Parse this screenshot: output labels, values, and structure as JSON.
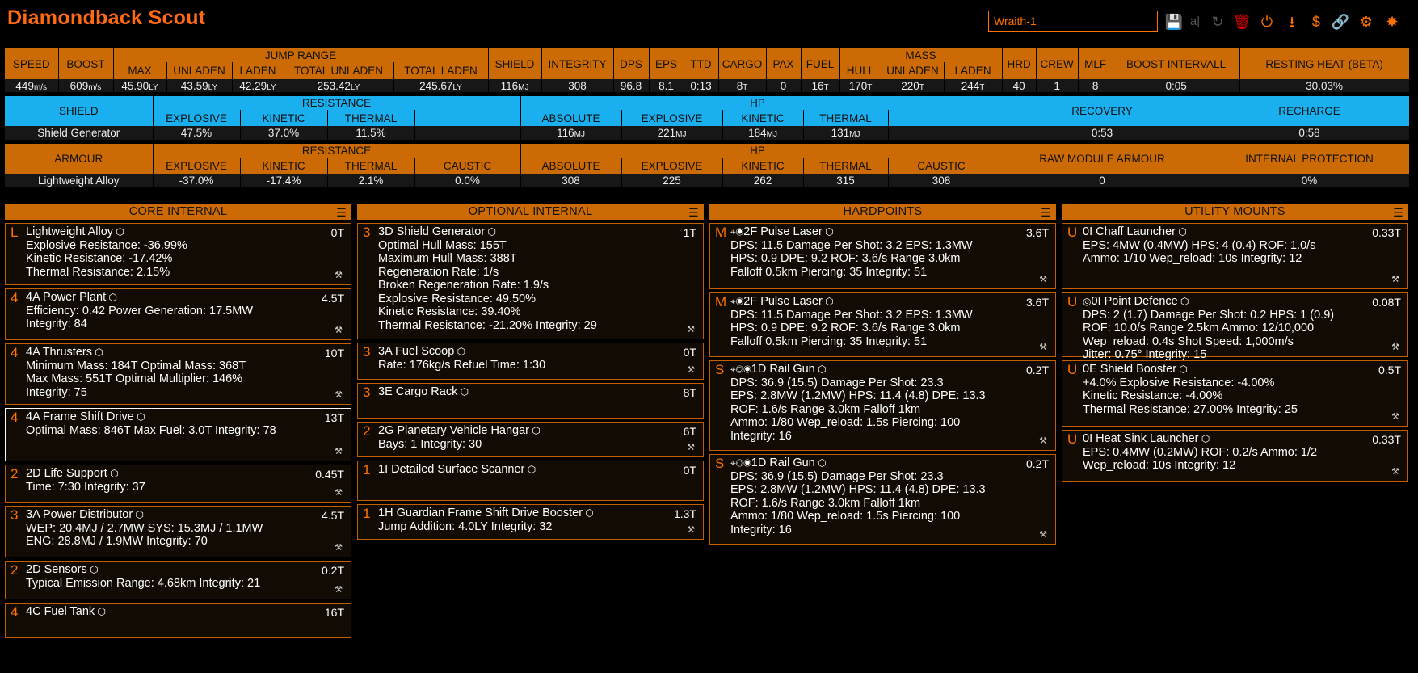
{
  "title": "Diamondback Scout",
  "build_name": "Wraith-1",
  "toolbar": {
    "save_icon": "💾",
    "rename_icon": "a|",
    "reset_icon": "↻",
    "delete_icon": "🗑",
    "power_icon": "⏻",
    "export_icon": "⭳",
    "cost_icon": "$",
    "link_icon": "🔗",
    "coriolis_icon": "⚙",
    "edsy_icon": "✸"
  },
  "stats": {
    "jump_range_label": "JUMP RANGE",
    "mass_label": "MASS",
    "headers": {
      "speed": "SPEED",
      "boost": "BOOST",
      "max": "MAX",
      "unladen": "UNLADEN",
      "laden": "LADEN",
      "total_unladen": "TOTAL UNLADEN",
      "total_laden": "TOTAL LADEN",
      "shield": "SHIELD",
      "integrity": "INTEGRITY",
      "dps": "DPS",
      "eps": "EPS",
      "ttd": "TTD",
      "cargo": "CARGO",
      "pax": "PAX",
      "fuel": "FUEL",
      "hull": "HULL",
      "mass_unladen": "UNLADEN",
      "mass_laden": "LADEN",
      "hrd": "HRD",
      "crew": "CREW",
      "mlf": "MLF",
      "boost_interval": "BOOST INTERVALL",
      "resting_heat": "RESTING HEAT (BETA)"
    },
    "values": {
      "speed": "449",
      "speed_unit": "m/s",
      "boost": "609",
      "boost_unit": "m/s",
      "max": "45.90",
      "unladen": "43.59",
      "laden": "42.29",
      "total_unladen": "253.42",
      "total_laden": "245.67",
      "ly": "LY",
      "shield": "116",
      "mj": "MJ",
      "integrity": "308",
      "dps": "96.8",
      "eps": "8.1",
      "ttd": "0:13",
      "cargo": "8",
      "t": "T",
      "pax": "0",
      "fuel": "16",
      "hull": "170",
      "mass_unladen": "220",
      "mass_laden": "244",
      "hrd": "40",
      "crew": "1",
      "mlf": "8",
      "boost_interval": "0:05",
      "resting_heat": "30.03%"
    }
  },
  "shield_table": {
    "shield": "SHIELD",
    "resistance": "RESISTANCE",
    "hp": "HP",
    "explosive": "EXPLOSIVE",
    "kinetic": "KINETIC",
    "thermal": "THERMAL",
    "absolute": "ABSOLUTE",
    "recovery": "RECOVERY",
    "recharge": "RECHARGE",
    "name": "Shield Generator",
    "res_explosive": "47.5%",
    "res_kinetic": "37.0%",
    "res_thermal": "11.5%",
    "hp_absolute": "116",
    "hp_explosive": "221",
    "hp_kinetic": "184",
    "hp_thermal": "131",
    "mj": "MJ",
    "recovery_val": "0:53",
    "recharge_val": "0:58"
  },
  "armour_table": {
    "armour": "ARMOUR",
    "resistance": "RESISTANCE",
    "hp": "HP",
    "explosive": "EXPLOSIVE",
    "kinetic": "KINETIC",
    "thermal": "THERMAL",
    "caustic": "CAUSTIC",
    "absolute": "ABSOLUTE",
    "raw_module_armour": "RAW MODULE ARMOUR",
    "internal_protection": "INTERNAL PROTECTION",
    "name": "Lightweight Alloy",
    "res_explosive": "-37.0%",
    "res_kinetic": "-17.4%",
    "res_thermal": "2.1%",
    "res_caustic": "0.0%",
    "hp_absolute": "308",
    "hp_explosive": "225",
    "hp_kinetic": "262",
    "hp_thermal": "315",
    "hp_caustic": "308",
    "raw_val": "0",
    "internal_val": "0%"
  },
  "panels": [
    {
      "title": "CORE INTERNAL",
      "cards": [
        {
          "cls": "L",
          "name": "Lightweight Alloy",
          "mass": "0T",
          "lines": [
            "Explosive Resistance: -36.99%",
            "Kinetic Resistance: -17.42%",
            "Thermal Resistance: 2.15%"
          ],
          "h": 77
        },
        {
          "cls": "4",
          "name": "4A Power Plant",
          "mass": "4.5T",
          "lines": [
            "Efficiency: 0.42   Power Generation: 17.5MW",
            "Integrity: 84"
          ],
          "h": 64
        },
        {
          "cls": "4",
          "name": "4A Thrusters",
          "mass": "10T",
          "lines": [
            "Minimum Mass: 184T   Optimal Mass: 368T",
            "Max Mass: 551T   Optimal Multiplier: 146%",
            "Integrity: 75"
          ],
          "h": 76
        },
        {
          "cls": "4",
          "name": "4A Frame Shift Drive",
          "mass": "13T",
          "lines": [
            "Optimal Mass: 846T   Max Fuel: 3.0T   Integrity: 78"
          ],
          "h": 66,
          "sel": true
        },
        {
          "cls": "2",
          "name": "2D Life Support",
          "mass": "0.45T",
          "lines": [
            "Time: 7:30   Integrity: 37"
          ],
          "h": 47
        },
        {
          "cls": "3",
          "name": "3A Power Distributor",
          "mass": "4.5T",
          "lines": [
            "WEP: 20.4MJ / 2.7MW   SYS: 15.3MJ / 1.1MW",
            "ENG: 28.8MJ / 1.9MW   Integrity: 70"
          ],
          "h": 64
        },
        {
          "cls": "2",
          "name": "2D Sensors",
          "mass": "0.2T",
          "lines": [
            "Typical Emission Range: 4.68km   Integrity: 21"
          ],
          "h": 48
        },
        {
          "cls": "4",
          "name": "4C Fuel Tank",
          "mass": "16T",
          "lines": [],
          "h": 44
        }
      ]
    },
    {
      "title": "OPTIONAL INTERNAL",
      "cards": [
        {
          "cls": "3",
          "name": "3D Shield Generator",
          "mass": "1T",
          "lines": [
            "Optimal Hull Mass: 155T",
            "Maximum Hull Mass: 388T",
            "Regeneration Rate: 1/s",
            "Broken Regeneration Rate: 1.9/s",
            "Explosive Resistance: 49.50%",
            "Kinetic Resistance: 39.40%",
            "Thermal Resistance: -21.20%   Integrity: 29"
          ],
          "h": 144
        },
        {
          "cls": "3",
          "name": "3A Fuel Scoop",
          "mass": "0T",
          "lines": [
            "Rate: 176kg/s   Refuel Time: 1:30"
          ],
          "h": 46
        },
        {
          "cls": "3",
          "name": "3E Cargo Rack",
          "mass": "8T",
          "lines": [],
          "h": 44
        },
        {
          "cls": "2",
          "name": "2G Planetary Vehicle Hangar",
          "mass": "6T",
          "lines": [
            "Bays: 1   Integrity: 30"
          ],
          "h": 44
        },
        {
          "cls": "1",
          "name": "1I Detailed Surface Scanner",
          "mass": "0T",
          "lines": [],
          "h": 50
        },
        {
          "cls": "1",
          "name": "1H Guardian Frame Shift Drive Booster",
          "mass": "1.3T",
          "lines": [
            "Jump Addition: 4.0LY   Integrity: 32"
          ],
          "h": 44
        }
      ]
    },
    {
      "title": "HARDPOINTS",
      "cards": [
        {
          "cls": "M",
          "name": "2F Pulse Laser",
          "icons": "⌖◉",
          "mass": "3.6T",
          "lines": [
            "DPS: 11.5   Damage Per Shot: 3.2   EPS: 1.3MW",
            "HPS: 0.9   DPE: 9.2   ROF: 3.6/s   Range 3.0km",
            "Falloff 0.5km   Piercing: 35   Integrity: 51"
          ],
          "h": 82
        },
        {
          "cls": "M",
          "name": "2F Pulse Laser",
          "icons": "⌖◉",
          "mass": "3.6T",
          "lines": [
            "DPS: 11.5   Damage Per Shot: 3.2   EPS: 1.3MW",
            "HPS: 0.9   DPE: 9.2   ROF: 3.6/s   Range 3.0km",
            "Falloff 0.5km   Piercing: 35   Integrity: 51"
          ],
          "h": 80
        },
        {
          "cls": "S",
          "name": "1D Rail Gun",
          "icons": "⌖◎◉",
          "mass": "0.2T",
          "lines": [
            "DPS: 36.9 (15.5)   Damage Per Shot: 23.3",
            "EPS: 2.8MW (1.2MW)   HPS: 11.4 (4.8)   DPE: 13.3",
            "ROF: 1.6/s   Range 3.0km   Falloff 1km",
            "Ammo: 1/80   Wep_reload: 1.5s   Piercing: 100",
            "Integrity: 16"
          ],
          "h": 112
        },
        {
          "cls": "S",
          "name": "1D Rail Gun",
          "icons": "⌖◎◉",
          "mass": "0.2T",
          "lines": [
            "DPS: 36.9 (15.5)   Damage Per Shot: 23.3",
            "EPS: 2.8MW (1.2MW)   HPS: 11.4 (4.8)   DPE: 13.3",
            "ROF: 1.6/s   Range 3.0km   Falloff 1km",
            "Ammo: 1/80   Wep_reload: 1.5s   Piercing: 100",
            "Integrity: 16"
          ],
          "h": 112
        }
      ]
    },
    {
      "title": "UTILITY MOUNTS",
      "cards": [
        {
          "cls": "U",
          "name": "0I Chaff Launcher",
          "mass": "0.33T",
          "lines": [
            "EPS: 4MW (0.4MW)   HPS: 4 (0.4)   ROF: 1.0/s",
            "Ammo: 1/10   Wep_reload: 10s   Integrity: 12"
          ],
          "h": 82
        },
        {
          "cls": "U",
          "name": "0I Point Defence",
          "icons": "◎",
          "mass": "0.08T",
          "lines": [
            "DPS: 2 (1.7)   Damage Per Shot: 0.2   HPS: 1 (0.9)",
            "ROF: 10.0/s   Range 2.5km   Ammo: 12/10,000",
            "Wep_reload: 0.4s   Shot Speed: 1,000m/s",
            "Jitter: 0.75°   Integrity: 15"
          ],
          "h": 80
        },
        {
          "cls": "U",
          "name": "0E Shield Booster",
          "mass": "0.5T",
          "lines": [
            "+4.0%   Explosive Resistance: -4.00%",
            "Kinetic Resistance: -4.00%",
            "Thermal Resistance: 27.00%   Integrity: 25"
          ],
          "h": 82
        },
        {
          "cls": "U",
          "name": "0I Heat Sink Launcher",
          "mass": "0.33T",
          "lines": [
            "EPS: 0.4MW (0.2MW)   ROF: 0.2/s   Ammo: 1/2",
            "Wep_reload: 10s   Integrity: 12"
          ],
          "h": 64
        }
      ]
    }
  ]
}
